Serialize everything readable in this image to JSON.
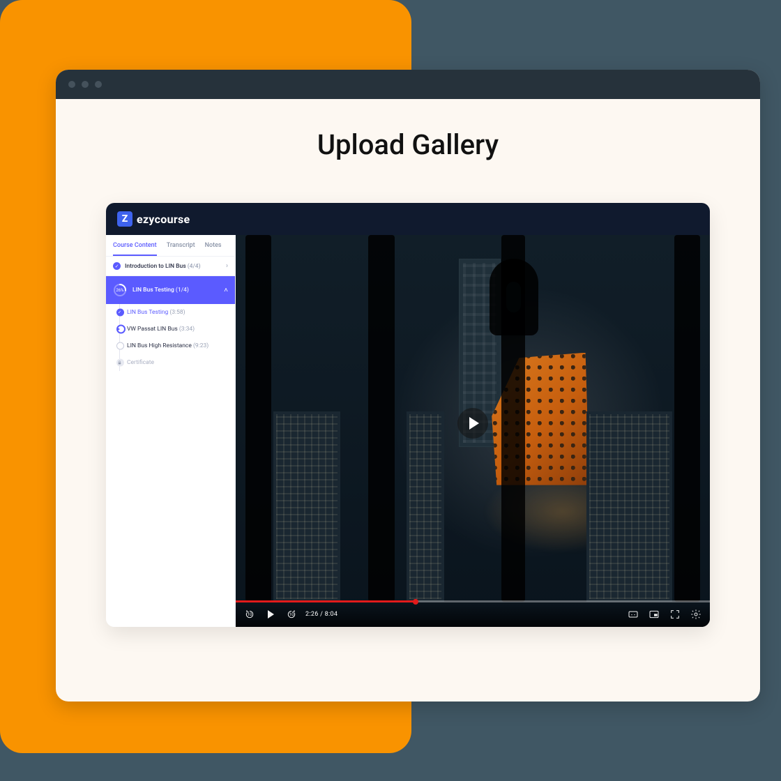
{
  "page": {
    "title": "Upload Gallery"
  },
  "brand": {
    "mark": "Z",
    "name": "ezycourse"
  },
  "tabs": [
    {
      "label": "Course Content",
      "active": true
    },
    {
      "label": "Transcript",
      "active": false
    },
    {
      "label": "Notes",
      "active": false
    }
  ],
  "section_completed": {
    "title": "Introduction to LIN Bus",
    "progress": "(4/4)"
  },
  "section_expanded": {
    "percent_label": "26%",
    "percent_value": 26,
    "title": "LIN Bus Testing",
    "progress": "(1/4)"
  },
  "lessons": [
    {
      "title": "LIN Bus Testing",
      "duration": "(3:58)",
      "state": "done"
    },
    {
      "title": "VW Passat LIN Bus",
      "duration": "(3:34)",
      "state": "current"
    },
    {
      "title": "LIN Bus High Resistance",
      "duration": "(9:23)",
      "state": "todo"
    },
    {
      "title": "Certificate",
      "duration": "",
      "state": "locked"
    }
  ],
  "player": {
    "current": "2:26",
    "total": "8:04",
    "time_display": "2:26 / 8:04",
    "rewind_label": "10",
    "forward_label": "10",
    "played_percent": 38
  },
  "colors": {
    "accent": "#5B5BFF",
    "orange": "#F99300",
    "page_bg": "#405764",
    "titlebar": "#26323B",
    "seek_played": "#E21B1B"
  }
}
